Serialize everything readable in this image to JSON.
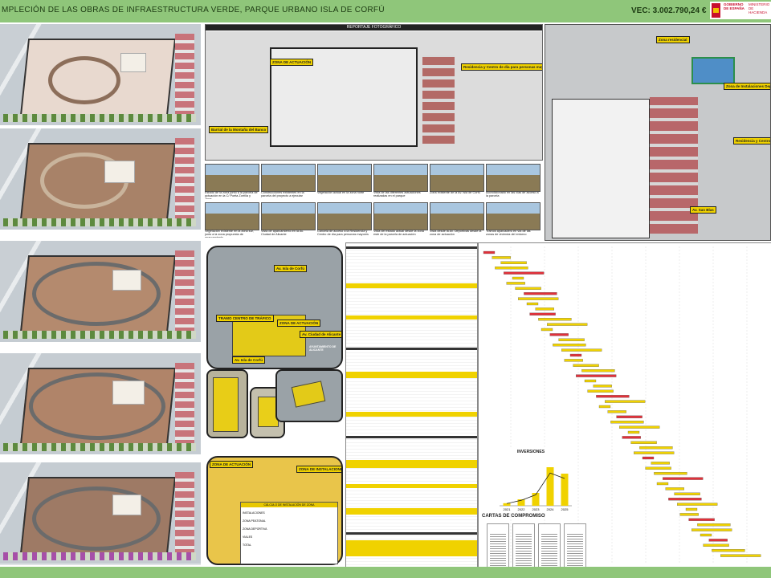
{
  "header": {
    "title": "MPLECIÓN DE LAS OBRAS DE INFRAESTRUCTURA VERDE, PARQUE URBANO ISLA DE CORFÚ",
    "budget": "VEC: 3.002.790,24 €",
    "gov_logo_line1": "GOBIERNO DE ESPAÑA",
    "gov_logo_line2": "MINISTERIO DE HACIENDA"
  },
  "photo_report": {
    "title": "REPORTAJE FOTOGRÁFICO",
    "tags": [
      "ZONA DE ACTUACIÓN",
      "Residencia y Centro de día para personas mayores",
      "Barrial de la Montaña del Banco"
    ],
    "captions": [
      "Estado de la zona junto a la parcela de actuación en la C/ Poeta Zorrilla y Tuna",
      "Construcciones existentes en la parcela del proyecto a ejecutar",
      "Vegetación actual en la zona norte",
      "Vista de las diferentes actuaciones realizadas en el parque",
      "Zona existente de la Av. Isla de Corfú",
      "Acondicionado en las vías de acceso a la parcela",
      "Vegetación existente en la zona sur, junto a la zona propuesta de aparcamiento",
      "Vista de aparcamiento en la Av. Ciudad de Alicante",
      "Cancela de acceso a la Residencia y Centro de día para personas mayores",
      "Vista del estado actual desde la zona este de la parcela de actuación",
      "Vista desde la Av. Deportivas desde la zona de actuación",
      "Tramos aparcadero en vía de las zonas de vivienda del entorno"
    ]
  },
  "aerial": {
    "tags": [
      "Zona residencial",
      "Zona de Instalaciones Deportivas",
      "Residencia y Centro de día para personas mayores",
      "Av. San Blas"
    ]
  },
  "location": {
    "tags": [
      "Av. Isla de Corfú",
      "TRAMO CENTRO DE TRÁFICO",
      "ZONA DE ACTUACIÓN",
      "Av. Ciudad de Alicante",
      "Av. Isla de Corfú"
    ],
    "logo_text": "AYUNTAMIENTO DE ALICANTE",
    "table_title": "CÁLCULO DE INSTALACIÓN DE ZONA",
    "table_rows": [
      "INSTALACIONES",
      "ZONA PEATONAL",
      "ZONA DEPORTIVA",
      "VIALES",
      "TOTAL"
    ],
    "zone_label": "ZONA DE INSTALACIONES DEPORTIVAS"
  },
  "chart_data": {
    "type": "bar",
    "title": "INVERSIONES",
    "categories": [
      "2021",
      "2022",
      "2023",
      "2024",
      "2025"
    ],
    "values": [
      80000,
      200000,
      400000,
      1200000,
      1000000
    ],
    "ylim": [
      0,
      1400000
    ],
    "series": [
      {
        "values": [
          80000,
          200000,
          400000,
          1200000,
          1000000
        ]
      }
    ]
  },
  "commitments": {
    "title": "CARTAS DE COMPROMISO"
  },
  "colors": {
    "accent": "#8fc67a",
    "highlight": "#f0d200",
    "gantt_red": "#e0313a"
  }
}
